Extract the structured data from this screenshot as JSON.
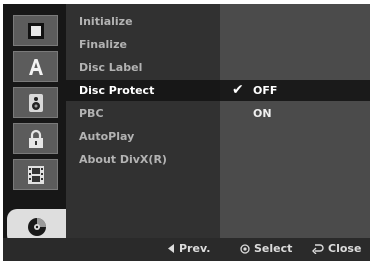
{
  "icons": [
    "film-frame-icon",
    "letter-a-icon",
    "speaker-icon",
    "padlock-icon",
    "film-strip-icon",
    "disc-icon"
  ],
  "menu": {
    "items": [
      {
        "label": "Initialize"
      },
      {
        "label": "Finalize"
      },
      {
        "label": "Disc Label"
      },
      {
        "label": "Disc Protect"
      },
      {
        "label": "PBC"
      },
      {
        "label": "AutoPlay"
      },
      {
        "label": "About DivX(R)"
      }
    ],
    "active_index": 3
  },
  "options": {
    "items": [
      {
        "label": "OFF"
      },
      {
        "label": "ON"
      }
    ],
    "selected_index": 0
  },
  "footer": {
    "prev_label": "Prev.",
    "select_label": "Select",
    "close_label": "Close"
  }
}
